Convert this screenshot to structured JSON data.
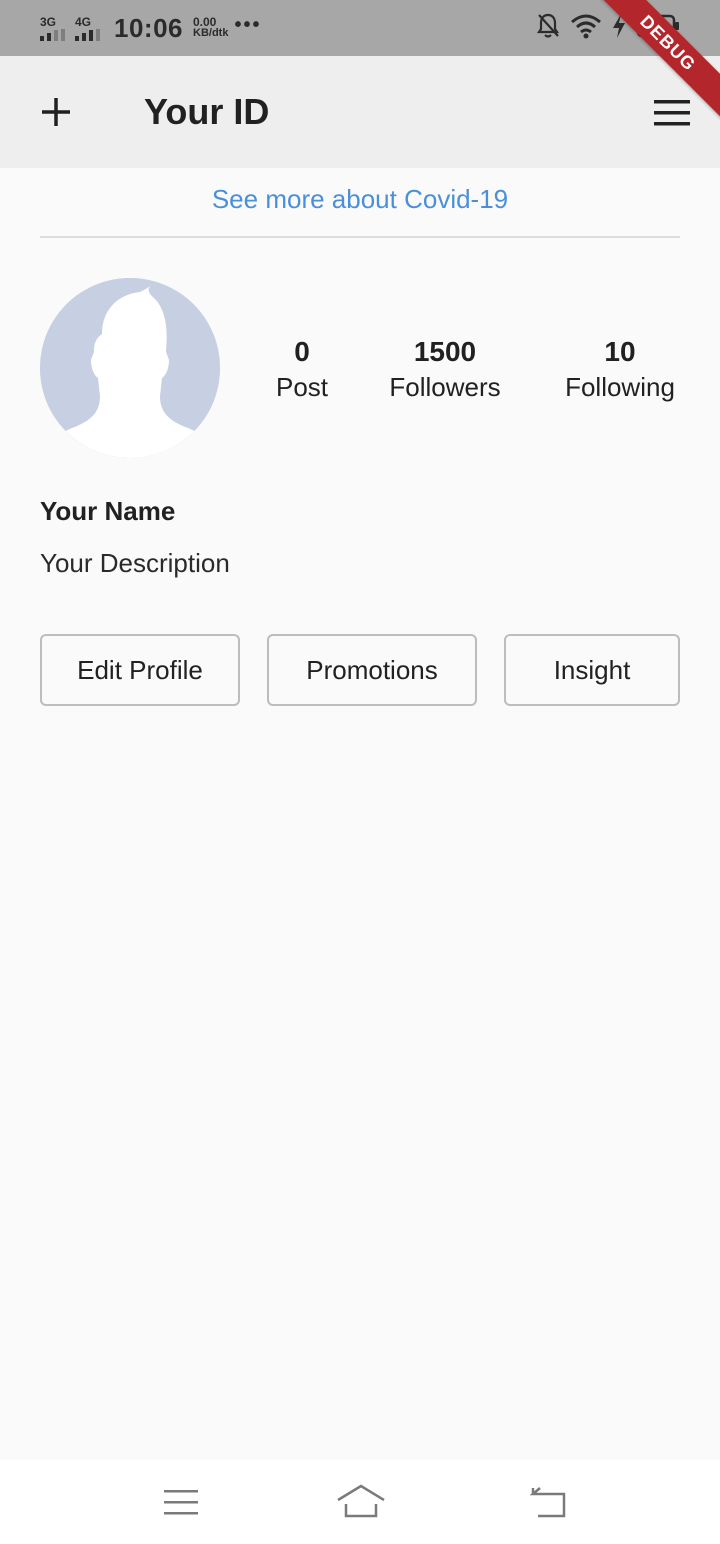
{
  "status_bar": {
    "sim1_label": "3G",
    "sim2_label": "4G",
    "time": "10:06",
    "speed_value": "0.00",
    "speed_unit": "KB/dtk",
    "more": "•••"
  },
  "debug_banner": "DEBUG",
  "app_bar": {
    "title": "Your ID",
    "add_icon": "plus-icon",
    "menu_icon": "hamburger-menu-icon"
  },
  "covid_link": "See more about Covid-19",
  "profile": {
    "avatar_icon": "default-user-silhouette",
    "stats": [
      {
        "value": "0",
        "label": "Post"
      },
      {
        "value": "1500",
        "label": "Followers"
      },
      {
        "value": "10",
        "label": "Following"
      }
    ],
    "name": "Your Name",
    "description": "Your Description"
  },
  "buttons": {
    "edit_profile": "Edit Profile",
    "promotions": "Promotions",
    "insight": "Insight"
  },
  "nav_bar": {
    "icons": [
      "menu-lines-icon",
      "home-icon",
      "back-icon"
    ]
  },
  "colors": {
    "link": "#4a90d9",
    "app_bar_bg": "#eeeeee",
    "avatar_bg": "#c7d0e3",
    "debug_banner": "#b3262b"
  }
}
